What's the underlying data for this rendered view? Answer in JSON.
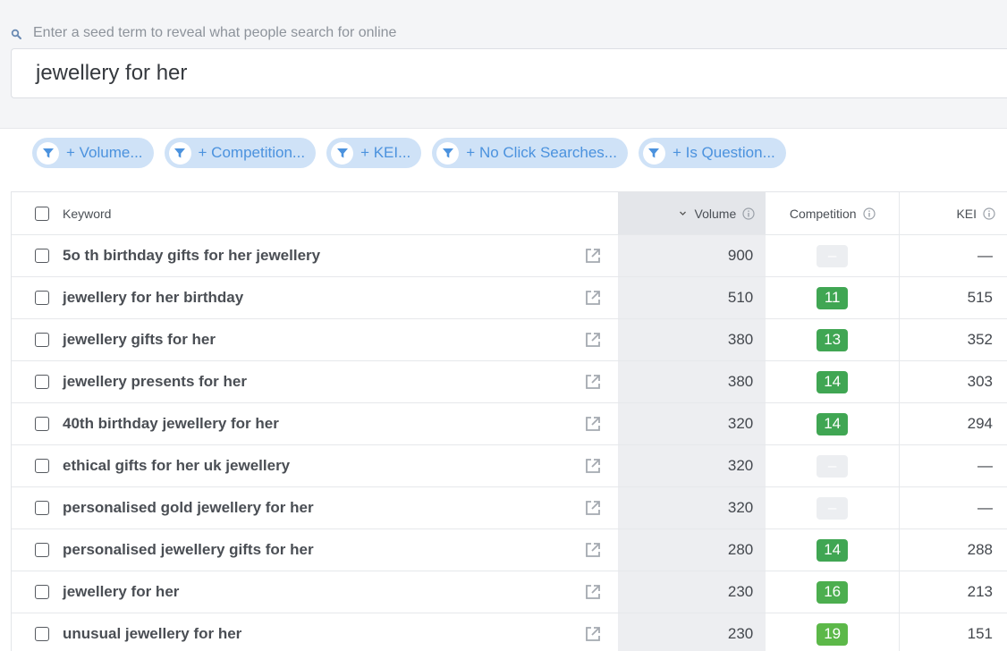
{
  "search": {
    "hint": "Enter a seed term to reveal what people search for online",
    "query": "jewellery for her"
  },
  "filters": [
    {
      "label": "+ Volume..."
    },
    {
      "label": "+ Competition..."
    },
    {
      "label": "+ KEI..."
    },
    {
      "label": "+ No Click Searches..."
    },
    {
      "label": "+ Is Question..."
    }
  ],
  "table": {
    "headers": {
      "keyword": "Keyword",
      "volume": "Volume",
      "competition": "Competition",
      "kei": "KEI"
    },
    "rows": [
      {
        "keyword": "5o th birthday gifts for her jewellery",
        "volume": "900",
        "competition": "–",
        "kei": "—",
        "comp_color": ""
      },
      {
        "keyword": "jewellery for her birthday",
        "volume": "510",
        "competition": "11",
        "kei": "515",
        "comp_color": "#40a653"
      },
      {
        "keyword": "jewellery gifts for her",
        "volume": "380",
        "competition": "13",
        "kei": "352",
        "comp_color": "#40a653"
      },
      {
        "keyword": "jewellery presents for her",
        "volume": "380",
        "competition": "14",
        "kei": "303",
        "comp_color": "#40a653"
      },
      {
        "keyword": "40th birthday jewellery for her",
        "volume": "320",
        "competition": "14",
        "kei": "294",
        "comp_color": "#40a653"
      },
      {
        "keyword": "ethical gifts for her uk jewellery",
        "volume": "320",
        "competition": "–",
        "kei": "—",
        "comp_color": ""
      },
      {
        "keyword": "personalised gold jewellery for her",
        "volume": "320",
        "competition": "–",
        "kei": "—",
        "comp_color": ""
      },
      {
        "keyword": "personalised jewellery gifts for her",
        "volume": "280",
        "competition": "14",
        "kei": "288",
        "comp_color": "#40a653"
      },
      {
        "keyword": "jewellery for her",
        "volume": "230",
        "competition": "16",
        "kei": "213",
        "comp_color": "#4cae4f"
      },
      {
        "keyword": "unusual jewellery for her",
        "volume": "230",
        "competition": "19",
        "kei": "151",
        "comp_color": "#5cb849"
      }
    ]
  },
  "colors": {
    "chip_bg": "#cfe2f7",
    "chip_text": "#4b92de",
    "badge_empty": "#eceef1"
  },
  "icons": {
    "search": "search-icon",
    "filter": "funnel-icon",
    "external": "external-link-icon",
    "info": "info-icon"
  }
}
